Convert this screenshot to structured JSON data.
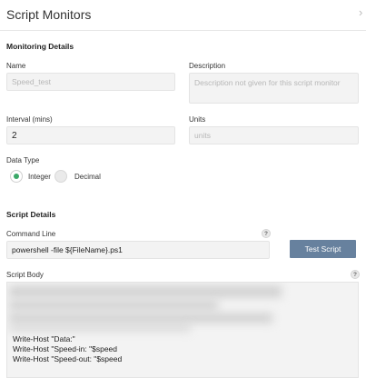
{
  "header": {
    "title": "Script Monitors",
    "close_icon": "chevron-right-icon"
  },
  "monitoring_details": {
    "section_title": "Monitoring Details",
    "name": {
      "label": "Name",
      "placeholder": "Speed_test"
    },
    "description": {
      "label": "Description",
      "placeholder": "Description not given for this script monitor"
    },
    "interval": {
      "label": "Interval (mins)",
      "value": "2"
    },
    "units": {
      "label": "Units",
      "placeholder": "units"
    },
    "data_type": {
      "label": "Data Type",
      "options": [
        {
          "label": "Integer",
          "selected": true
        },
        {
          "label": "Decimal",
          "selected": false
        }
      ]
    }
  },
  "script_details": {
    "section_title": "Script Details",
    "command_line": {
      "label": "Command Line",
      "value": "powershell -file ${FileName}.ps1",
      "help": "?"
    },
    "test_button": "Test Script",
    "script_body": {
      "label": "Script Body",
      "help": "?",
      "lines": [
        "Write-Host \"Data:\"",
        "Write-Host \"Speed-in: \"$speed",
        "Write-Host \"Speed-out: \"$speed"
      ]
    }
  },
  "colors": {
    "accent_green": "#3aa868",
    "button_blue": "#67819e"
  }
}
